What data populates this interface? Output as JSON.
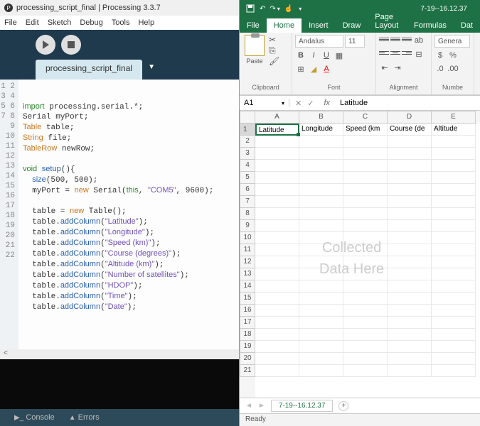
{
  "processing": {
    "title": "processing_script_final | Processing 3.3.7",
    "menu": [
      "File",
      "Edit",
      "Sketch",
      "Debug",
      "Tools",
      "Help"
    ],
    "tab": "processing_script_final",
    "code_lines": [
      {
        "n": 1,
        "html": ""
      },
      {
        "n": 2,
        "html": ""
      },
      {
        "n": 3,
        "html": "<span class='kw'>import</span> processing.serial.*;"
      },
      {
        "n": 4,
        "html": "Serial myPort;"
      },
      {
        "n": 5,
        "html": "<span class='ty'>Table</span> table;"
      },
      {
        "n": 6,
        "html": "<span class='ty'>String</span> file;"
      },
      {
        "n": 7,
        "html": "<span class='ty'>TableRow</span> newRow;"
      },
      {
        "n": 8,
        "html": ""
      },
      {
        "n": 9,
        "html": "<span class='kw'>void</span> <span class='fn'>setup</span>(){"
      },
      {
        "n": 10,
        "html": "  <span class='fn'>size</span>(500, 500);"
      },
      {
        "n": 11,
        "html": "  myPort = <span class='ty'>new</span> Serial(<span class='kw'>this</span>, <span class='st'>\"COM5\"</span>, 9600);"
      },
      {
        "n": 12,
        "html": ""
      },
      {
        "n": 13,
        "html": "  table = <span class='ty'>new</span> Table();"
      },
      {
        "n": 14,
        "html": "  table.<span class='fn'>addColumn</span>(<span class='st'>\"Latitude\"</span>);"
      },
      {
        "n": 15,
        "html": "  table.<span class='fn'>addColumn</span>(<span class='st'>\"Longitude\"</span>);"
      },
      {
        "n": 16,
        "html": "  table.<span class='fn'>addColumn</span>(<span class='st'>\"Speed (km)\"</span>);"
      },
      {
        "n": 17,
        "html": "  table.<span class='fn'>addColumn</span>(<span class='st'>\"Course (degrees)\"</span>);"
      },
      {
        "n": 18,
        "html": "  table.<span class='fn'>addColumn</span>(<span class='st'>\"Altitude (km)\"</span>);"
      },
      {
        "n": 19,
        "html": "  table.<span class='fn'>addColumn</span>(<span class='st'>\"Number of satellites\"</span>);"
      },
      {
        "n": 20,
        "html": "  table.<span class='fn'>addColumn</span>(<span class='st'>\"HDOP\"</span>);"
      },
      {
        "n": 21,
        "html": "  table.<span class='fn'>addColumn</span>(<span class='st'>\"Time\"</span>);"
      },
      {
        "n": 22,
        "html": "  table.<span class='fn'>addColumn</span>(<span class='st'>\"Date\"</span>);"
      }
    ],
    "footer": {
      "console": "Console",
      "errors": "Errors"
    }
  },
  "excel": {
    "filename": "7-19--16.12.37",
    "tabs": [
      "File",
      "Home",
      "Insert",
      "Draw",
      "Page Layout",
      "Formulas",
      "Dat"
    ],
    "active_tab": "Home",
    "ribbon": {
      "clipboard": "Clipboard",
      "paste": "Paste",
      "font": "Font",
      "fontname": "Andalus",
      "fontsize": "11",
      "alignment": "Alignment",
      "number": "Numbe",
      "general": "Genera"
    },
    "namebox": {
      "cell": "A1",
      "fx": "fx",
      "value": "Latitude"
    },
    "cols": [
      "A",
      "B",
      "C",
      "D",
      "E"
    ],
    "headers": [
      "Latitude",
      "Longitude",
      "Speed (km",
      "Course (de",
      "Altitude"
    ],
    "rows": 21,
    "watermark_l1": "Collected",
    "watermark_l2": "Data Here",
    "sheet": "7-19--16.12.37",
    "status": "Ready"
  }
}
